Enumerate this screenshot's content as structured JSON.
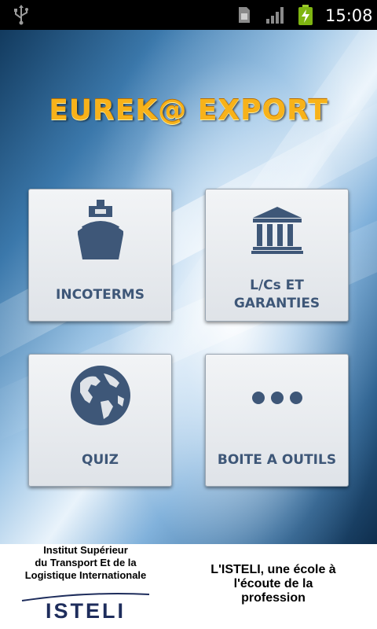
{
  "status_bar": {
    "time": "15:08",
    "icons": [
      "usb-icon",
      "sim-card-icon",
      "signal-icon",
      "battery-charging-icon"
    ]
  },
  "app": {
    "title": "EUREK@ EXPORT",
    "tiles": [
      {
        "label_lines": [
          "INCOTERMS"
        ],
        "icon": "ship-icon"
      },
      {
        "label_lines": [
          "L/Cs ET",
          "GARANTIES"
        ],
        "icon": "bank-icon"
      },
      {
        "label_lines": [
          "QUIZ"
        ],
        "icon": "globe-icon"
      },
      {
        "label_lines": [
          "BOITE A OUTILS"
        ],
        "icon": "more-dots-icon"
      }
    ],
    "colors": {
      "title": "#f7b21a",
      "tile_label": "#3e5778",
      "icon": "#3e5778"
    }
  },
  "footer": {
    "institute_lines": [
      "Institut Supérieur",
      "du Transport Et de la",
      "Logistique Internationale"
    ],
    "logo": "ISTELI",
    "tagline_lines": [
      "L'ISTELI, une école à",
      "l'écoute de la",
      "profession"
    ]
  }
}
